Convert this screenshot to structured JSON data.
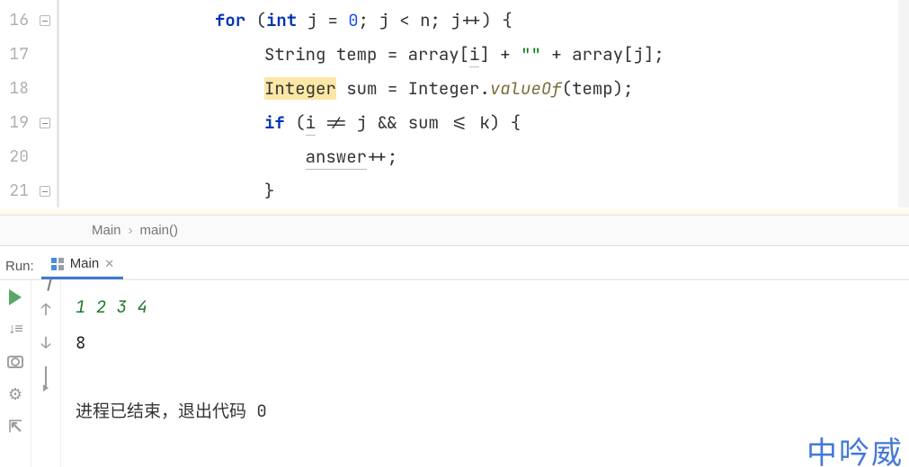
{
  "editor": {
    "line_numbers": [
      "16",
      "17",
      "18",
      "19",
      "20",
      "21"
    ],
    "folds": [
      true,
      false,
      false,
      true,
      false,
      true
    ],
    "code": {
      "l16": {
        "for": "for",
        "lp": "(",
        "int": "int",
        "j": "j",
        "eq": "=",
        "zero": "0",
        "sc": ";",
        "j2": "j",
        "lt": "<",
        "n": "n",
        "sc2": ";",
        "j3": "j",
        "inc": "++",
        "rp": ")",
        "ob": "{"
      },
      "l17": {
        "String": "String",
        "temp": "temp",
        "eq": "=",
        "array1": "array[",
        "i": "i",
        "cb1": "]",
        "plus1": "+",
        "str": "\"\"",
        "plus2": "+",
        "array2": "array[",
        "j": "j",
        "cb2": "];"
      },
      "l18": {
        "Integer": "Integer",
        "sum": "sum",
        "eq": "=",
        "Integer2": "Integer",
        "dot": ".",
        "valueOf": "valueOf",
        "lp": "(",
        "temp": "temp",
        "rp": ");"
      },
      "l19": {
        "if": "if",
        "lp": "(",
        "i": "i",
        "neq": "!=",
        "j": "j",
        "amp": "&&",
        "sum": "sum",
        "lte": "<=",
        "k": "k",
        "rp": ")",
        "ob": "{"
      },
      "l20": {
        "answer": "answer",
        "inc": "++;"
      },
      "l21": {
        "cb": "}"
      }
    }
  },
  "breadcrumb": {
    "items": [
      "Main",
      "main()"
    ]
  },
  "run": {
    "label": "Run:",
    "tab_name": "Main",
    "console": {
      "input": "1 2 3 4",
      "output": "8",
      "exit": "进程已结束，退出代码 0"
    }
  },
  "watermark": "中吟威"
}
